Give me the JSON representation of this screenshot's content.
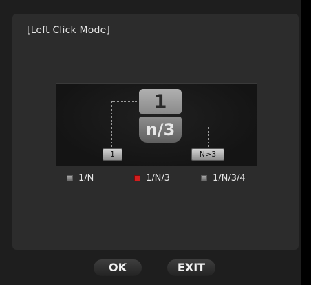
{
  "panel": {
    "title": "[Left Click Mode]"
  },
  "diagram": {
    "top_label": "1",
    "bottom_label": "n/3",
    "left_node": "1",
    "right_node": "N>3"
  },
  "options": [
    {
      "label": "1/N",
      "selected": false
    },
    {
      "label": "1/N/3",
      "selected": true
    },
    {
      "label": "1/N/3/4",
      "selected": false
    }
  ],
  "buttons": {
    "ok": "OK",
    "exit": "EXIT"
  },
  "colors": {
    "selected": "#d21f1f",
    "panel": "#2c2c2c",
    "background": "#1e1e1e"
  }
}
